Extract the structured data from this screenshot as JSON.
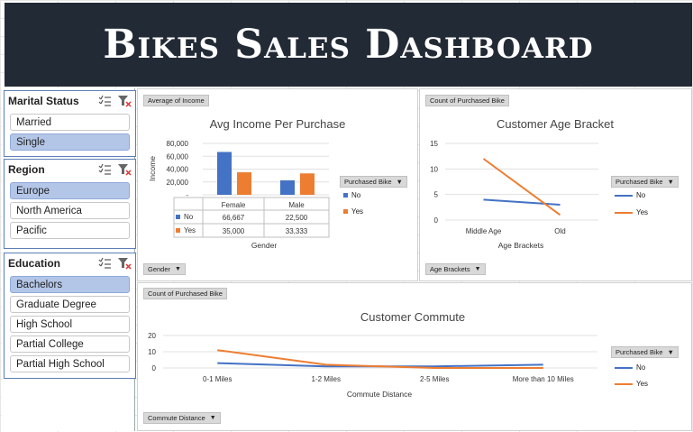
{
  "title": "Bikes Sales Dashboard",
  "colors": {
    "blue": "#4472c4",
    "orange": "#ed7d31",
    "banner": "#222a35",
    "selected": "#b4c6e7"
  },
  "slicers": [
    {
      "title": "Marital Status",
      "items": [
        {
          "label": "Married",
          "selected": false
        },
        {
          "label": "Single",
          "selected": true
        }
      ]
    },
    {
      "title": "Region",
      "items": [
        {
          "label": "Europe",
          "selected": true
        },
        {
          "label": "North America",
          "selected": false
        },
        {
          "label": "Pacific",
          "selected": false
        }
      ]
    },
    {
      "title": "Education",
      "items": [
        {
          "label": "Bachelors",
          "selected": true
        },
        {
          "label": "Graduate Degree",
          "selected": false
        },
        {
          "label": "High School",
          "selected": false
        },
        {
          "label": "Partial College",
          "selected": false
        },
        {
          "label": "Partial High School",
          "selected": false
        }
      ]
    }
  ],
  "income_chart": {
    "value_button": "Average of Income",
    "axis_button": "Gender",
    "legend_title": "Purchased Bike",
    "legend": [
      "No",
      "Yes"
    ],
    "title": "Avg Income Per Purchase",
    "ylabel": "Income",
    "xlabel": "Gender",
    "ytick_labels": [
      "80,000",
      "60,000",
      "40,000",
      "20,000",
      "-"
    ],
    "table_rows": [
      {
        "label": "No",
        "values": [
          "66,667",
          "22,500"
        ]
      },
      {
        "label": "Yes",
        "values": [
          "35,000",
          "33,333"
        ]
      }
    ]
  },
  "age_chart": {
    "value_button": "Count of Purchased Bike",
    "axis_button": "Age Brackets",
    "legend_title": "Purchased Bike",
    "legend": [
      "No",
      "Yes"
    ],
    "title": "Customer Age Bracket",
    "xlabel": "Age Brackets",
    "ytick_labels": [
      "15",
      "10",
      "5",
      "0"
    ]
  },
  "commute_chart": {
    "value_button": "Count of Purchased Bike",
    "axis_button": "Commute Distance",
    "legend_title": "Purchased Bike",
    "legend": [
      "No",
      "Yes"
    ],
    "title": "Customer Commute",
    "xlabel": "Commute Distance",
    "ytick_labels": [
      "20",
      "10",
      "0"
    ]
  },
  "chart_data": [
    {
      "type": "bar",
      "title": "Avg Income Per Purchase",
      "xlabel": "Gender",
      "ylabel": "Income",
      "categories": [
        "Female",
        "Male"
      ],
      "series": [
        {
          "name": "No",
          "values": [
            66667,
            22500
          ]
        },
        {
          "name": "Yes",
          "values": [
            35000,
            33333
          ]
        }
      ],
      "ylim": [
        0,
        80000
      ],
      "legend": "right"
    },
    {
      "type": "line",
      "title": "Customer Age Bracket",
      "xlabel": "Age Brackets",
      "categories": [
        "Middle Age",
        "Old"
      ],
      "series": [
        {
          "name": "No",
          "values": [
            4,
            3
          ]
        },
        {
          "name": "Yes",
          "values": [
            12,
            1
          ]
        }
      ],
      "ylim": [
        0,
        15
      ],
      "legend": "right"
    },
    {
      "type": "line",
      "title": "Customer Commute",
      "xlabel": "Commute Distance",
      "categories": [
        "0-1 Miles",
        "1-2 Miles",
        "2-5 Miles",
        "More than 10 Miles"
      ],
      "series": [
        {
          "name": "No",
          "values": [
            3,
            1,
            1,
            2
          ]
        },
        {
          "name": "Yes",
          "values": [
            11,
            2,
            0,
            0
          ]
        }
      ],
      "ylim": [
        0,
        20
      ],
      "legend": "right"
    }
  ]
}
